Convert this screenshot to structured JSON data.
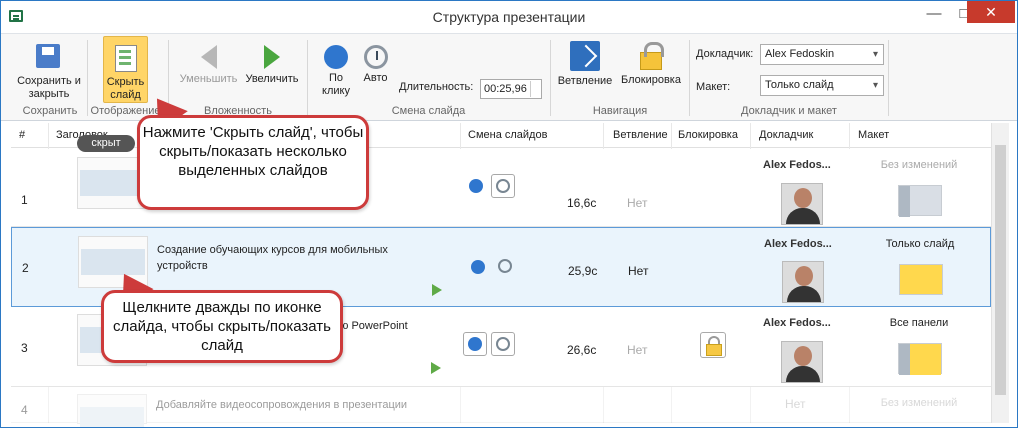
{
  "window": {
    "title": "Структура презентации"
  },
  "ribbon": {
    "save_label": "Сохранить и закрыть",
    "save_group": "Сохранить",
    "hide_label": "Скрыть слайд",
    "display_group": "Отображение",
    "decrease_label": "Уменьшить",
    "increase_label": "Увеличить",
    "nesting_group": "Вложенность",
    "click_label": "По клику",
    "auto_label": "Авто",
    "duration_label": "Длительность:",
    "duration_value": "00:25,96",
    "slide_change_group": "Смена слайда",
    "branch_label": "Ветвление",
    "lock_label": "Блокировка",
    "navigation_group": "Навигация",
    "speaker_label": "Докладчик:",
    "speaker_value": "Alex Fedoskin",
    "layout_label": "Макет:",
    "layout_value": "Только слайд",
    "speaker_group": "Докладчик и макет"
  },
  "table": {
    "headers": [
      "#",
      "Заголовок",
      "Смена слайдов",
      "Ветвление",
      "Блокировка",
      "Докладчик",
      "Макет"
    ],
    "rows": [
      {
        "number": "1",
        "title": "",
        "duration": "16,6с",
        "branch": "Нет",
        "speaker": "Alex Fedos...",
        "layout": "Без изменений"
      },
      {
        "number": "2",
        "title": "Создание обучающих курсов для мобильных устройств",
        "duration": "25,9с",
        "branch": "Нет",
        "speaker": "Alex Fedos...",
        "layout": "Только слайд"
      },
      {
        "number": "3",
        "title": "...ю PowerPoint",
        "duration": "26,6с",
        "branch": "Нет",
        "speaker": "Alex Fedos...",
        "layout": "Все панели"
      },
      {
        "number": "4",
        "title": "Добавляйте видеосопровождения в презентации",
        "duration": "",
        "branch": "Нет",
        "speaker": "",
        "layout": "Без изменений"
      }
    ],
    "hidden_badge": "скрыт"
  },
  "callouts": {
    "hide_tip": "Нажмите 'Скрыть слайд', чтобы скрыть/показать несколько выделенных слайдов",
    "double_click_tip": "Щелкните дважды по иконке слайда, чтобы скрыть/показать слайд"
  },
  "colors": {
    "accent": "#2f76ce",
    "callout_border": "#cd3b3b",
    "selected_row": "#eaf4fc",
    "highlight": "#ffd567"
  }
}
